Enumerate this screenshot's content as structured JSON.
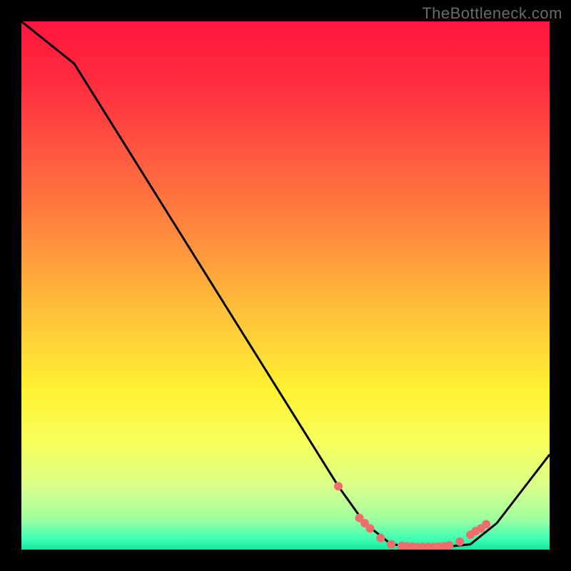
{
  "watermark": "TheBottleneck.com",
  "chart_data": {
    "type": "line",
    "title": "",
    "xlabel": "",
    "ylabel": "",
    "xlim": [
      0,
      100
    ],
    "ylim": [
      0,
      100
    ],
    "grid": false,
    "legend": false,
    "series": [
      {
        "name": "curve",
        "x": [
          0,
          10,
          20,
          30,
          40,
          50,
          60,
          65,
          70,
          75,
          80,
          85,
          90,
          100
        ],
        "y": [
          100,
          92,
          76,
          60,
          44,
          28,
          12,
          5,
          1,
          0.5,
          0.5,
          1,
          5,
          18
        ]
      }
    ],
    "points": {
      "name": "marked-points",
      "x": [
        60,
        64,
        65,
        66,
        68,
        70,
        72,
        73,
        74,
        75,
        76,
        77,
        78,
        79,
        80,
        81,
        83,
        85,
        86,
        87,
        88
      ],
      "y": [
        12,
        6,
        5,
        4,
        2.2,
        1,
        0.7,
        0.6,
        0.55,
        0.5,
        0.5,
        0.5,
        0.5,
        0.55,
        0.6,
        0.8,
        1.5,
        2.8,
        3.5,
        4,
        4.8
      ]
    },
    "background_gradient": {
      "stops": [
        {
          "offset": 0.0,
          "color": "#ff163e"
        },
        {
          "offset": 0.12,
          "color": "#ff2d3f"
        },
        {
          "offset": 0.25,
          "color": "#ff5840"
        },
        {
          "offset": 0.4,
          "color": "#ff8a3e"
        },
        {
          "offset": 0.55,
          "color": "#ffc13a"
        },
        {
          "offset": 0.7,
          "color": "#fff233"
        },
        {
          "offset": 0.8,
          "color": "#f6ff5c"
        },
        {
          "offset": 0.88,
          "color": "#d9ff8a"
        },
        {
          "offset": 0.94,
          "color": "#a2ff9e"
        },
        {
          "offset": 0.98,
          "color": "#3dffb2"
        },
        {
          "offset": 1.0,
          "color": "#14e79e"
        }
      ]
    },
    "line_color": "#000000",
    "point_color": "#ef6d6d"
  }
}
